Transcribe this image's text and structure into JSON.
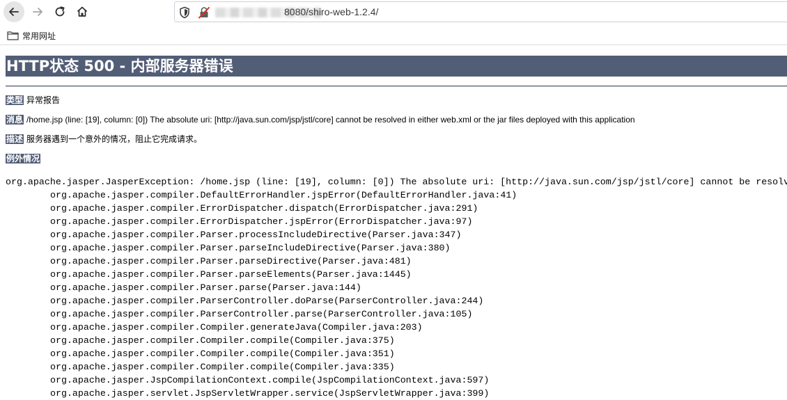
{
  "browser": {
    "url_text": "8080/shiro-web-1.2.4/",
    "bookmarks": [
      {
        "label": "常用网址"
      }
    ]
  },
  "page": {
    "title": "HTTP状态 500 - 内部服务器错误",
    "type": {
      "label": "类型",
      "value": "异常报告"
    },
    "message": {
      "label": "消息",
      "value": "/home.jsp (line: [19], column: [0]) The absolute uri: [http://java.sun.com/jsp/jstl/core] cannot be resolved in either web.xml or the jar files deployed with this application"
    },
    "description": {
      "label": "描述",
      "value": "服务器遇到一个意外的情况，阻止它完成请求。"
    },
    "exception": {
      "label": "例外情况"
    },
    "stack_head": "org.apache.jasper.JasperException: /home.jsp (line: [19], column: [0]) The absolute uri: [http://java.sun.com/jsp/jstl/core] cannot be resolv",
    "stack_frames": [
      "org.apache.jasper.compiler.DefaultErrorHandler.jspError(DefaultErrorHandler.java:41)",
      "org.apache.jasper.compiler.ErrorDispatcher.dispatch(ErrorDispatcher.java:291)",
      "org.apache.jasper.compiler.ErrorDispatcher.jspError(ErrorDispatcher.java:97)",
      "org.apache.jasper.compiler.Parser.processIncludeDirective(Parser.java:347)",
      "org.apache.jasper.compiler.Parser.parseIncludeDirective(Parser.java:380)",
      "org.apache.jasper.compiler.Parser.parseDirective(Parser.java:481)",
      "org.apache.jasper.compiler.Parser.parseElements(Parser.java:1445)",
      "org.apache.jasper.compiler.Parser.parse(Parser.java:144)",
      "org.apache.jasper.compiler.ParserController.doParse(ParserController.java:244)",
      "org.apache.jasper.compiler.ParserController.parse(ParserController.java:105)",
      "org.apache.jasper.compiler.Compiler.generateJava(Compiler.java:203)",
      "org.apache.jasper.compiler.Compiler.compile(Compiler.java:375)",
      "org.apache.jasper.compiler.Compiler.compile(Compiler.java:351)",
      "org.apache.jasper.compiler.Compiler.compile(Compiler.java:335)",
      "org.apache.jasper.JspCompilationContext.compile(JspCompilationContext.java:597)",
      "org.apache.jasper.servlet.JspServletWrapper.service(JspServletWrapper.java:399)"
    ]
  },
  "icons": {
    "back": "arrow-left-icon",
    "forward": "arrow-right-icon",
    "reload": "reload-icon",
    "home": "home-icon",
    "shield": "shield-icon",
    "lock": "insecure-lock-icon",
    "folder": "folder-icon"
  },
  "colors": {
    "header_bg": "#525d76",
    "header_text": "#ffffff"
  }
}
